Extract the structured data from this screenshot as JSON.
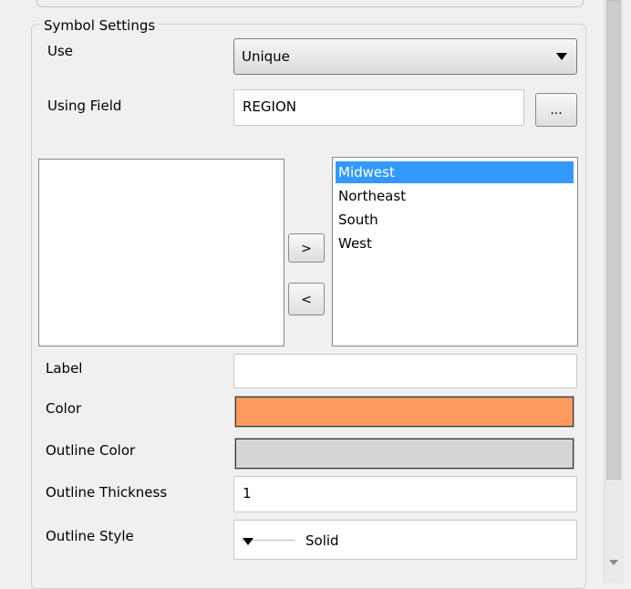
{
  "symbol_settings": {
    "title": "Symbol Settings",
    "use": {
      "label": "Use",
      "value": "Unique"
    },
    "using_field": {
      "label": "Using Field",
      "value": "REGION",
      "browse_label": "..."
    },
    "available_list": {
      "items": []
    },
    "move_right_label": ">",
    "move_left_label": "<",
    "selected_list": {
      "items": [
        "Midwest",
        "Northeast",
        "South",
        "West"
      ],
      "selected_index": 0
    },
    "label_field": {
      "label": "Label",
      "value": ""
    },
    "color": {
      "label": "Color",
      "value": "#fd9b5f"
    },
    "outline_color": {
      "label": "Outline Color",
      "value": "#d6d6d6"
    },
    "outline_thickness": {
      "label": "Outline Thickness",
      "value": "1"
    },
    "outline_style": {
      "label": "Outline Style",
      "value": "Solid"
    }
  },
  "colors": {
    "selection": "#3399ff",
    "panel_bg": "#f0f0f0"
  }
}
